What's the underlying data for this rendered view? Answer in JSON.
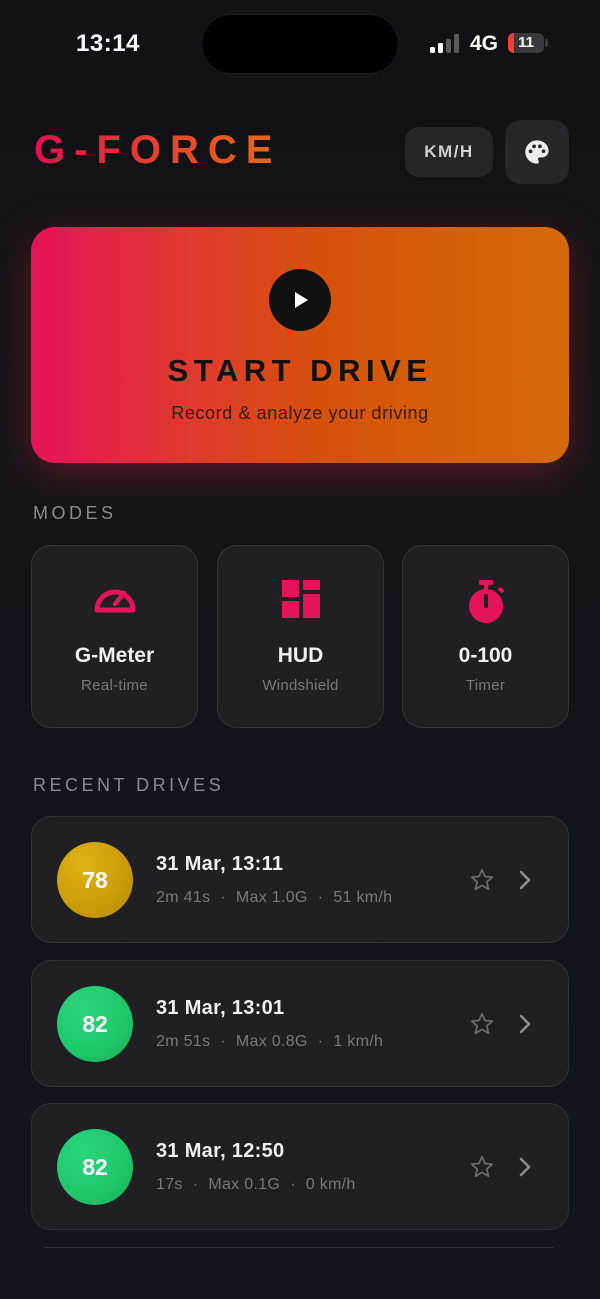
{
  "status_bar": {
    "time": "13:14",
    "network": "4G",
    "battery": "11"
  },
  "header": {
    "logo": "G-FORCE",
    "unit_label": "KM/H",
    "palette_icon": "palette-icon"
  },
  "start_card": {
    "title": "START DRIVE",
    "subtitle": "Record & analyze your driving",
    "icon": "play-icon"
  },
  "modes": {
    "title": "MODES",
    "items": [
      {
        "label": "G-Meter",
        "sub": "Real-time",
        "icon": "speedometer-icon"
      },
      {
        "label": "HUD",
        "sub": "Windshield",
        "icon": "grid-icon"
      },
      {
        "label": "0-100",
        "sub": "Timer",
        "icon": "stopwatch-icon"
      }
    ]
  },
  "recent": {
    "title": "RECENT DRIVES",
    "items": [
      {
        "score": "78",
        "date": "31 Mar, 13:11",
        "duration": "2m 41s",
        "max_g": "Max 1.0G",
        "speed": "51 km/h",
        "sep": "·",
        "score_color": "#d9a50a"
      },
      {
        "score": "82",
        "date": "31 Mar, 13:01",
        "duration": "2m 51s",
        "max_g": "Max 0.8G",
        "speed": "1 km/h",
        "sep": "·",
        "score_color": "#1fc76a"
      },
      {
        "score": "82",
        "date": "31 Mar, 12:50",
        "duration": "17s",
        "max_g": "Max 0.1G",
        "speed": "0 km/h",
        "sep": "·",
        "score_color": "#1fc76a"
      }
    ]
  },
  "colors": {
    "accent": "#e5135a",
    "accent_orange": "#d56a0c",
    "background": "#141419",
    "card": "#1f1f24"
  }
}
